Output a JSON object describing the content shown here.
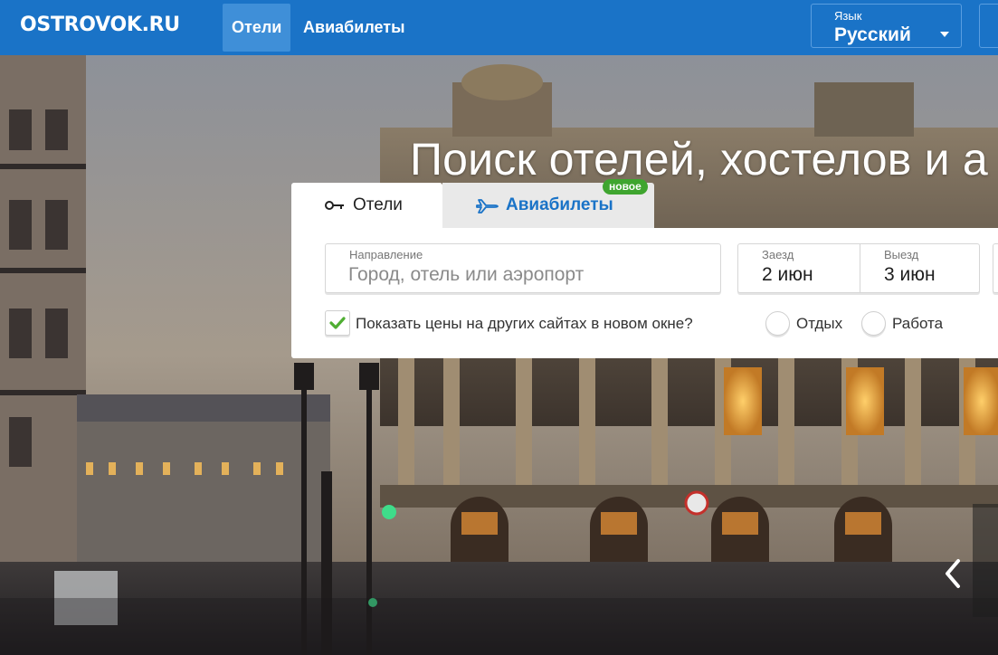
{
  "header": {
    "logo": "OSTROVOK.RU",
    "tabs": [
      {
        "label": "Отели",
        "active": true
      },
      {
        "label": "Авиабилеты",
        "active": false
      }
    ],
    "language": {
      "label": "Язык",
      "value": "Русский"
    }
  },
  "hero": {
    "headline": "Поиск отелей, хостелов и а"
  },
  "search": {
    "tabs": [
      {
        "label": "Отели",
        "icon": "key-icon",
        "active": true
      },
      {
        "label": "Авиабилеты",
        "icon": "airplane-icon",
        "active": false,
        "badge": "новое"
      }
    ],
    "destination": {
      "label": "Направление",
      "placeholder": "Город, отель или аэропорт",
      "value": ""
    },
    "checkin": {
      "label": "Заезд",
      "value": "2 июн"
    },
    "checkout": {
      "label": "Выезд",
      "value": "3 июн"
    },
    "compare_prices": {
      "label": "Показать цены на других сайтах в новом окне?",
      "checked": true
    },
    "trip_purpose": [
      {
        "label": "Отдых",
        "selected": false
      },
      {
        "label": "Работа",
        "selected": false
      }
    ]
  },
  "colors": {
    "header_bg": "#1a73c7",
    "active_tab": "#3f8fd8",
    "badge": "#3fa52f",
    "check": "#4fae32"
  }
}
